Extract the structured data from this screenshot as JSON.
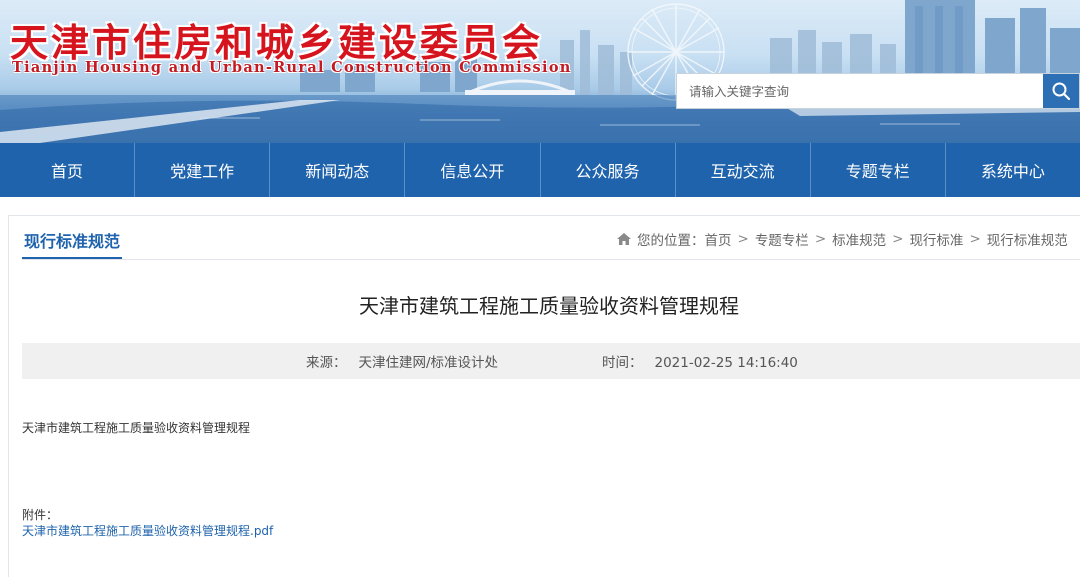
{
  "header": {
    "site_title": "天津市住房和城乡建设委员会",
    "site_subtitle": "Tianjin Housing and Urban-Rural Construction Commission",
    "search": {
      "placeholder": "请输入关键字查询",
      "value": "",
      "icon": "search-icon"
    },
    "colors": {
      "title_red": "#d6141e",
      "nav_blue": "#1f63ad",
      "search_button": "#2c6fb5"
    }
  },
  "nav": {
    "items": [
      {
        "label": "首页"
      },
      {
        "label": "党建工作"
      },
      {
        "label": "新闻动态"
      },
      {
        "label": "信息公开"
      },
      {
        "label": "公众服务"
      },
      {
        "label": "互动交流"
      },
      {
        "label": "专题专栏"
      },
      {
        "label": "系统中心"
      }
    ]
  },
  "section": {
    "tab_label": "现行标准规范",
    "breadcrumb": {
      "icon": "home-icon",
      "prefix": "您的位置：",
      "separator": ">",
      "items": [
        "首页",
        "专题专栏",
        "标准规范",
        "现行标准",
        "现行标准规范"
      ]
    }
  },
  "article": {
    "title": "天津市建筑工程施工质量验收资料管理规程",
    "source_label": "来源：",
    "source_value": "天津住建网/标准设计处",
    "time_label": "时间：",
    "time_value": "2021-02-25 14:16:40",
    "body": "天津市建筑工程施工质量验收资料管理规程",
    "attachment_label": "附件：",
    "attachment_link": "天津市建筑工程施工质量验收资料管理规程.pdf"
  }
}
